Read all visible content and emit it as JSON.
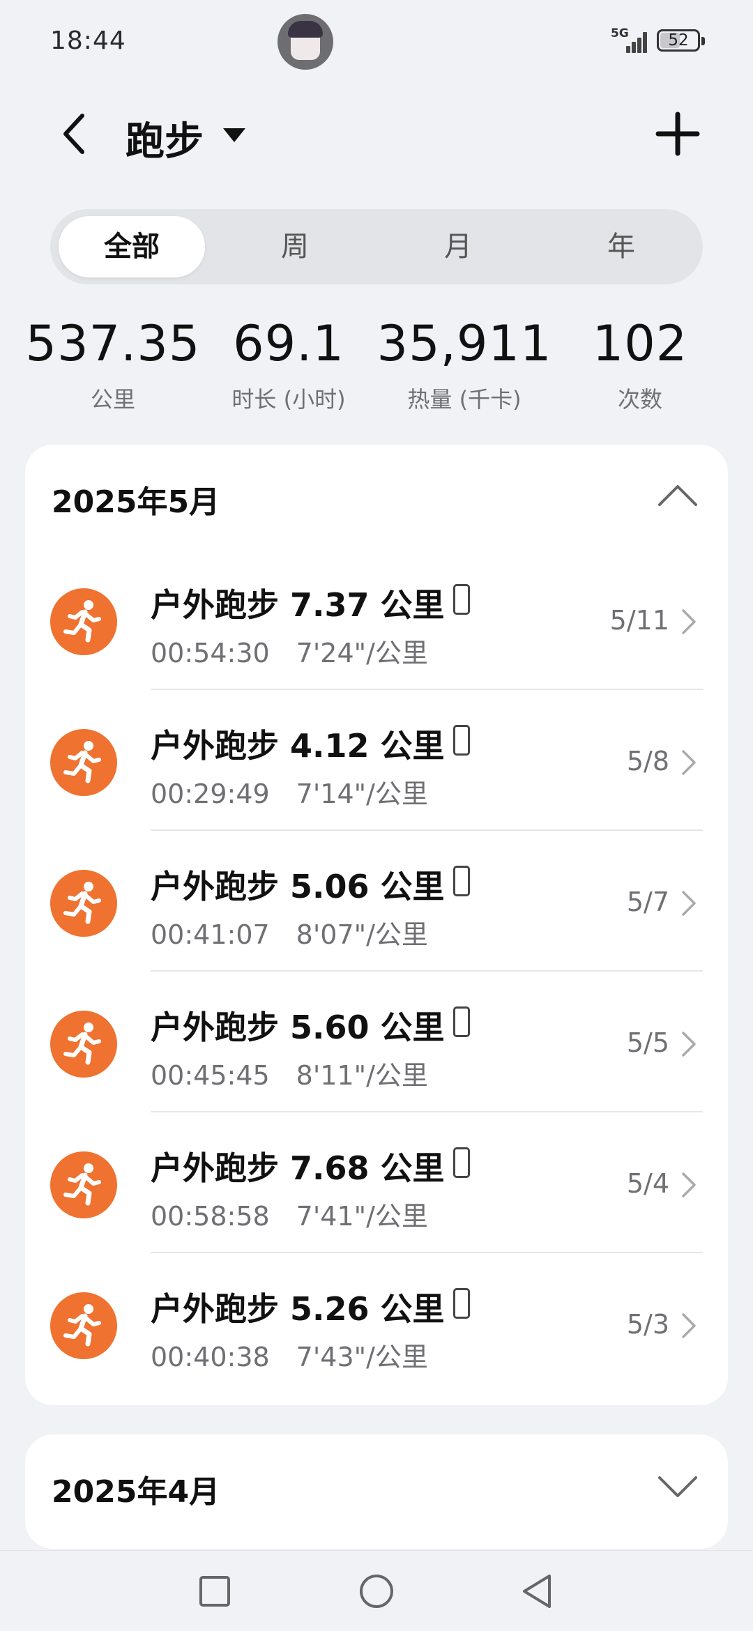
{
  "status_bar": {
    "time": "18:44",
    "network": "5G",
    "battery": "52"
  },
  "header": {
    "title": "跑步"
  },
  "tabs": [
    {
      "label": "全部",
      "active": true
    },
    {
      "label": "周",
      "active": false
    },
    {
      "label": "月",
      "active": false
    },
    {
      "label": "年",
      "active": false
    }
  ],
  "stats": [
    {
      "value": "537.35",
      "label": "公里"
    },
    {
      "value": "69.1",
      "label": "时长 (小时)"
    },
    {
      "value": "35,911",
      "label": "热量 (千卡)"
    },
    {
      "value": "102",
      "label": "次数"
    }
  ],
  "months": [
    {
      "title": "2025年5月",
      "expanded": true,
      "records": [
        {
          "name": "户外跑步 7.37 公里",
          "duration": "00:54:30",
          "pace": "7'24\"/公里",
          "date": "5/11"
        },
        {
          "name": "户外跑步 4.12 公里",
          "duration": "00:29:49",
          "pace": "7'14\"/公里",
          "date": "5/8"
        },
        {
          "name": "户外跑步 5.06 公里",
          "duration": "00:41:07",
          "pace": "8'07\"/公里",
          "date": "5/7"
        },
        {
          "name": "户外跑步 5.60 公里",
          "duration": "00:45:45",
          "pace": "8'11\"/公里",
          "date": "5/5"
        },
        {
          "name": "户外跑步 7.68 公里",
          "duration": "00:58:58",
          "pace": "7'41\"/公里",
          "date": "5/4"
        },
        {
          "name": "户外跑步 5.26 公里",
          "duration": "00:40:38",
          "pace": "7'43\"/公里",
          "date": "5/3"
        }
      ]
    },
    {
      "title": "2025年4月",
      "expanded": false
    }
  ],
  "colors": {
    "accent": "#ef7230",
    "background": "#f1f2f6"
  },
  "icons": [
    "back-arrow-icon",
    "dropdown-caret-icon",
    "plus-icon",
    "running-icon",
    "phone-icon",
    "chevron-right-icon",
    "chevron-up-icon",
    "chevron-down-icon",
    "recents-square-icon",
    "home-circle-icon",
    "back-triangle-icon"
  ]
}
